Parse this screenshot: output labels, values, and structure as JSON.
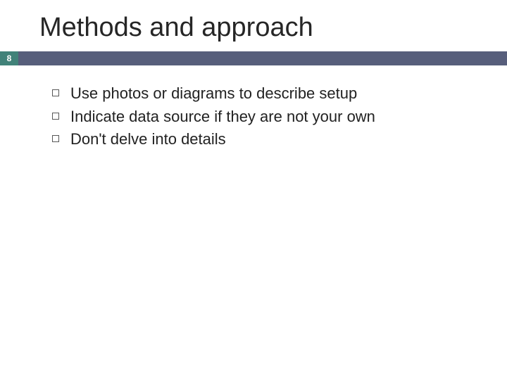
{
  "slide": {
    "title": "Methods and approach",
    "page_number": "8",
    "bullets": [
      "Use photos or diagrams to describe setup",
      "Indicate data source if they are not your own",
      "Don't delve into details"
    ]
  },
  "colors": {
    "bar": "#575e7b",
    "page_box": "#418279"
  }
}
